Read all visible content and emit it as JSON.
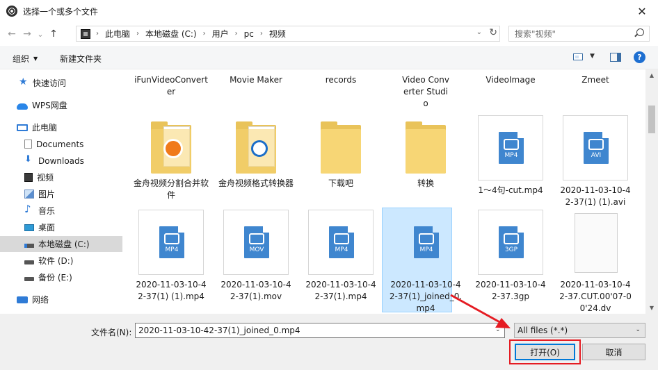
{
  "window": {
    "title": "选择一个或多个文件",
    "close_glyph": "✕"
  },
  "nav": {
    "back": "←",
    "forward": "→",
    "recent": "⌄",
    "up": "↑"
  },
  "address": {
    "crumbs": [
      "此电脑",
      "本地磁盘 (C:)",
      "用户",
      "pc",
      "视频"
    ],
    "sep": "›",
    "dropdown": "⌄",
    "refresh": "↻"
  },
  "search": {
    "placeholder": "搜索\"视频\""
  },
  "toolbar": {
    "organize": "组织",
    "new_folder": "新建文件夹",
    "caret": "▼"
  },
  "sidebar": {
    "items": [
      {
        "label": "快速访问",
        "icon": "star-icon"
      },
      {
        "label": "WPS网盘",
        "icon": "cloud-icon"
      },
      {
        "label": "此电脑",
        "icon": "computer-icon"
      },
      {
        "label": "Documents",
        "icon": "documents-icon"
      },
      {
        "label": "Downloads",
        "icon": "download-icon"
      },
      {
        "label": "视频",
        "icon": "video-icon"
      },
      {
        "label": "图片",
        "icon": "picture-icon"
      },
      {
        "label": "音乐",
        "icon": "music-icon"
      },
      {
        "label": "桌面",
        "icon": "desktop-icon"
      },
      {
        "label": "本地磁盘 (C:)",
        "icon": "drive-c-icon",
        "selected": true
      },
      {
        "label": "软件 (D:)",
        "icon": "drive-icon"
      },
      {
        "label": "备份 (E:)",
        "icon": "drive-icon"
      },
      {
        "label": "网络",
        "icon": "network-icon"
      }
    ]
  },
  "files": {
    "row0": [
      "iFunVideoConverter",
      "Movie Maker",
      "records",
      "Video Converter Studio",
      "VideoImage",
      "Zmeet"
    ],
    "row1": [
      {
        "name": "金舟视频分割合并软件",
        "kind": "folder-app"
      },
      {
        "name": "金舟视频格式转换器",
        "kind": "folder-disc"
      },
      {
        "name": "下载吧",
        "kind": "folder"
      },
      {
        "name": "转换",
        "kind": "folder"
      },
      {
        "name": "1～4句-cut.mp4",
        "kind": "video",
        "ext": "MP4"
      },
      {
        "name": "2020-11-03-10-42-37(1) (1).avi",
        "kind": "video",
        "ext": "AVI"
      }
    ],
    "row2": [
      {
        "name": "2020-11-03-10-42-37(1) (1).mp4",
        "kind": "video",
        "ext": "MP4"
      },
      {
        "name": "2020-11-03-10-42-37(1).mov",
        "kind": "video",
        "ext": "MOV"
      },
      {
        "name": "2020-11-03-10-42-37(1).mp4",
        "kind": "video",
        "ext": "MP4"
      },
      {
        "name": "2020-11-03-10-42-37(1)_joined_0.mp4",
        "kind": "video",
        "ext": "MP4",
        "selected": true
      },
      {
        "name": "2020-11-03-10-42-37.3gp",
        "kind": "video",
        "ext": "3GP"
      },
      {
        "name": "2020-11-03-10-42-37.CUT.00'07-00'24.dv",
        "kind": "blank"
      }
    ]
  },
  "scroll": {
    "up": "▲",
    "down": "▼"
  },
  "bottom": {
    "filename_label": "文件名(N):",
    "filename_value": "2020-11-03-10-42-37(1)_joined_0.mp4",
    "filetype_value": "All files (*.*)",
    "dd": "⌄",
    "open_label": "打开(O)",
    "cancel_label": "取消"
  },
  "colors": {
    "accent": "#0078d7",
    "annotation": "#e51c23",
    "selection": "#cce8ff"
  }
}
